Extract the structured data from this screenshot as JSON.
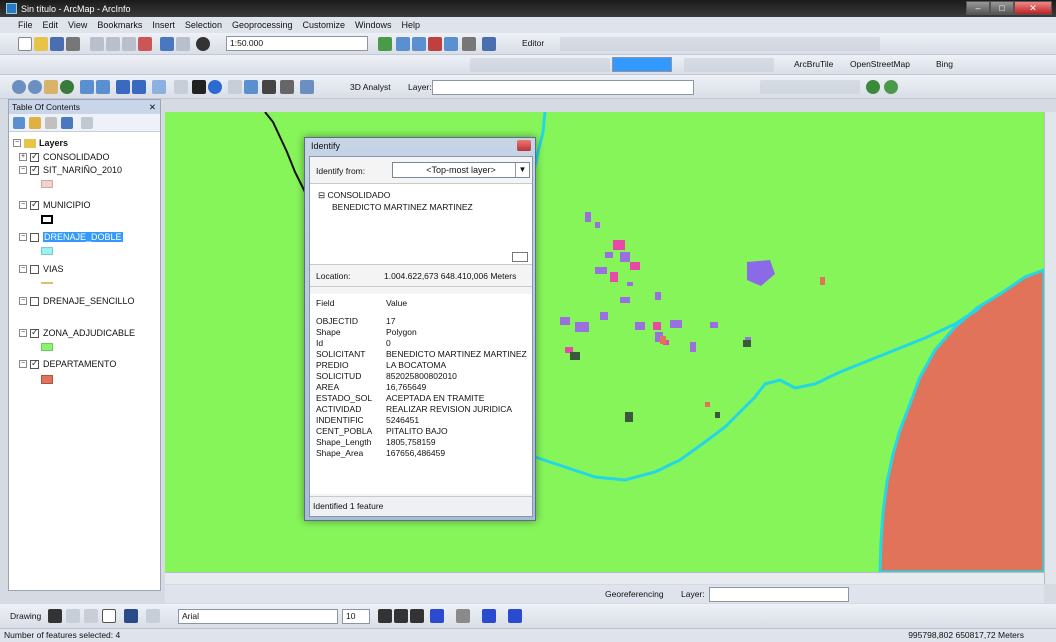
{
  "window": {
    "title": "Sin título - ArcMap - ArcInfo"
  },
  "menu": [
    "File",
    "Edit",
    "View",
    "Bookmarks",
    "Insert",
    "Selection",
    "Geoprocessing",
    "Customize",
    "Windows",
    "Help"
  ],
  "toolbar": {
    "scale": "1:50.000",
    "editor_label": "Editor",
    "arcbrutile_label": "ArcBruTile",
    "openstreetmap_label": "OpenStreetMap",
    "bing_label": "Bing",
    "analyst_label": "3D Analyst",
    "layer_label": "Layer:"
  },
  "toc": {
    "title": "Table Of Contents",
    "close_label": "  ᐧ ✕",
    "root": "Layers",
    "layers": [
      {
        "name": "CONSOLIDADO",
        "checked": true
      },
      {
        "name": "SIT_NARIÑO_2010",
        "checked": true,
        "swatch": "#f3d2c8"
      },
      {
        "name": "MUNICIPIO",
        "checked": true
      },
      {
        "name": "DRENAJE_DOBLE",
        "checked": false,
        "swatch": "#9cf0f0",
        "selected": true
      },
      {
        "name": "VIAS",
        "checked": false
      },
      {
        "name": "DRENAJE_SENCILLO",
        "checked": false
      },
      {
        "name": "ZONA_ADJUDICABLE",
        "checked": true,
        "swatch": "#8df26b"
      },
      {
        "name": "DEPARTAMENTO",
        "checked": true,
        "swatch": "#e0735a"
      }
    ]
  },
  "identify": {
    "title": "Identify",
    "from_label": "Identify from:",
    "from_value": "<Top-most layer>",
    "tree_layer": "CONSOLIDADO",
    "tree_feature": "BENEDICTO MARTINEZ MARTINEZ",
    "location_label": "Location:",
    "location_value": "1.004.622,673  648.410,006 Meters",
    "field_header": "Field",
    "value_header": "Value",
    "rows": [
      {
        "field": "OBJECTID",
        "value": "17"
      },
      {
        "field": "Shape",
        "value": "Polygon"
      },
      {
        "field": "Id",
        "value": "0"
      },
      {
        "field": "SOLICITANT",
        "value": "BENEDICTO MARTINEZ MARTINEZ"
      },
      {
        "field": "PREDIO",
        "value": "LA BOCATOMA"
      },
      {
        "field": "SOLICITUD",
        "value": "852025800802010"
      },
      {
        "field": "AREA",
        "value": "16,765649"
      },
      {
        "field": "ESTADO_SOL",
        "value": "ACEPTADA EN TRAMITE"
      },
      {
        "field": "ACTIVIDAD",
        "value": "REALIZAR REVISION JURIDICA"
      },
      {
        "field": "INDENTIFIC",
        "value": "5246451"
      },
      {
        "field": "CENT_POBLA",
        "value": "PITALITO BAJO"
      },
      {
        "field": "Shape_Length",
        "value": "1805,758159"
      },
      {
        "field": "Shape_Area",
        "value": "167656,486459"
      }
    ],
    "footer": "Identified 1 feature"
  },
  "georef": {
    "label": "Georeferencing",
    "layer_label": "Layer:"
  },
  "drawing": {
    "label": "Drawing",
    "font": "Arial",
    "size": "10"
  },
  "status": {
    "left": "Number of features selected: 4",
    "coords": "995798,802  650817,72 Meters"
  },
  "colors": {
    "map_bg": "#86f55a",
    "departamento": "#e0735a",
    "river": "#25d6e6",
    "selection": "#3399ff"
  }
}
